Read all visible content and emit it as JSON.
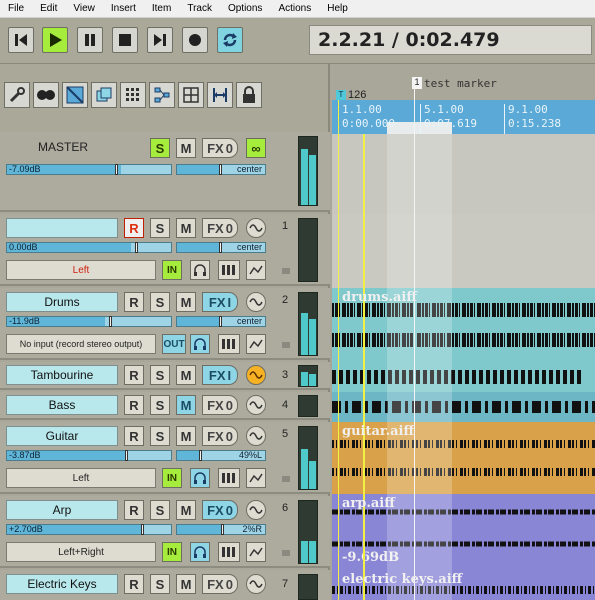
{
  "menu": [
    "File",
    "Edit",
    "View",
    "Insert",
    "Item",
    "Track",
    "Options",
    "Actions",
    "Help"
  ],
  "transport": {
    "time_display": "2.2.21 / 0:02.479",
    "buttons": [
      "skip-start",
      "play",
      "pause",
      "stop",
      "skip-end",
      "record",
      "repeat"
    ]
  },
  "toolbar": {
    "tools": [
      "wrench",
      "grouping",
      "snap",
      "ripple-edit",
      "grid",
      "envelope",
      "crossfade",
      "split",
      "lock"
    ]
  },
  "timeline": {
    "tempo_marker": "T",
    "tempo": "126",
    "marker_number": "1",
    "marker_name": "test marker",
    "ruler": [
      {
        "bar": "1.1.00",
        "time": "0:00.000"
      },
      {
        "bar": "5.1.00",
        "time": "0:07.619"
      },
      {
        "bar": "9.1.00",
        "time": "0:15.238"
      }
    ]
  },
  "master": {
    "name": "MASTER",
    "solo": "S",
    "mute": "M",
    "fx": "FX",
    "fx_count": "0",
    "volume": "-7.09dB",
    "pan": "center",
    "infinity": "∞"
  },
  "tracks": [
    {
      "number": "1",
      "name": "",
      "rec": "R",
      "solo": "S",
      "mute": "M",
      "fx": "FX",
      "fx_count": "0",
      "volume": "0.00dB",
      "pan": "center",
      "input": "Left",
      "input_mode": "IN"
    },
    {
      "number": "2",
      "name": "Drums",
      "rec": "R",
      "solo": "S",
      "mute": "M",
      "fx": "FX",
      "fx_count": "I",
      "volume": "-11.9dB",
      "pan": "center",
      "input": "No input (record stereo output)",
      "input_mode": "OUT"
    },
    {
      "number": "3",
      "name": "Tambourine",
      "rec": "R",
      "solo": "S",
      "mute": "M",
      "fx": "FX",
      "fx_count": "I"
    },
    {
      "number": "4",
      "name": "Bass",
      "rec": "R",
      "solo": "S",
      "mute": "M",
      "fx": "FX",
      "fx_count": "0"
    },
    {
      "number": "5",
      "name": "Guitar",
      "rec": "R",
      "solo": "S",
      "mute": "M",
      "fx": "FX",
      "fx_count": "0",
      "volume": "-3.87dB",
      "pan": "49%L",
      "input": "Left",
      "input_mode": "IN"
    },
    {
      "number": "6",
      "name": "Arp",
      "rec": "R",
      "solo": "S",
      "mute": "M",
      "fx": "FX",
      "fx_count": "0",
      "volume": "+2.70dB",
      "pan": "2%R",
      "input": "Left+Right",
      "input_mode": "IN"
    },
    {
      "number": "7",
      "name": "Electric Keys",
      "rec": "R",
      "solo": "S",
      "mute": "M",
      "fx": "FX",
      "fx_count": "0"
    }
  ],
  "clips": {
    "drums": "drums.aiff",
    "guitar": "guitar.aiff",
    "arp": "arp.aiff",
    "arp_volume": "-9.69dB",
    "keys": "electric keys.aiff"
  },
  "colors": {
    "accent_green": "#a6ec3d",
    "accent_cyan": "#8ed6e6",
    "drums_lane": "#7fc9cc",
    "guitar_lane": "#d9a24a",
    "arp_lane": "#8a86d6",
    "playhead": "#f2f040"
  }
}
